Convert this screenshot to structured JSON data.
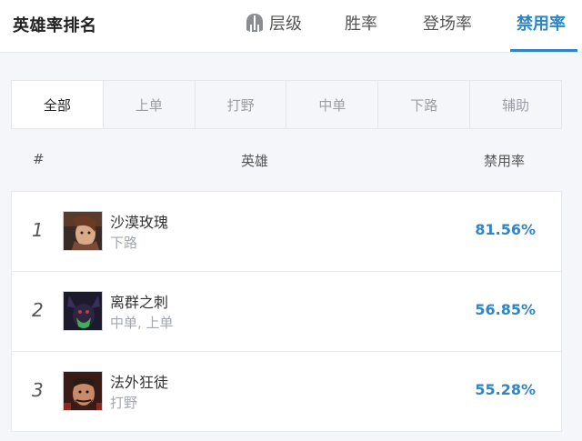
{
  "header": {
    "title": "英雄率排名",
    "nav": {
      "tier": "层级",
      "win_rate": "胜率",
      "pick_rate": "登场率",
      "ban_rate": "禁用率"
    }
  },
  "position_tabs": [
    "全部",
    "上单",
    "打野",
    "中单",
    "下路",
    "辅助"
  ],
  "table": {
    "columns": {
      "rank": "#",
      "hero": "英雄",
      "ban_rate": "禁用率"
    },
    "rows": [
      {
        "rank": "1",
        "name": "沙漠玫瑰",
        "role": "下路",
        "ban_rate": "81.56%"
      },
      {
        "rank": "2",
        "name": "离群之刺",
        "role": "中单, 上单",
        "ban_rate": "56.85%"
      },
      {
        "rank": "3",
        "name": "法外狂徒",
        "role": "打野",
        "ban_rate": "55.28%"
      }
    ]
  },
  "colors": {
    "accent": "#2f86c4",
    "background": "#f3f5f8",
    "muted_text": "#a3a7ae"
  },
  "icons": {
    "tier": "helmet-icon"
  }
}
